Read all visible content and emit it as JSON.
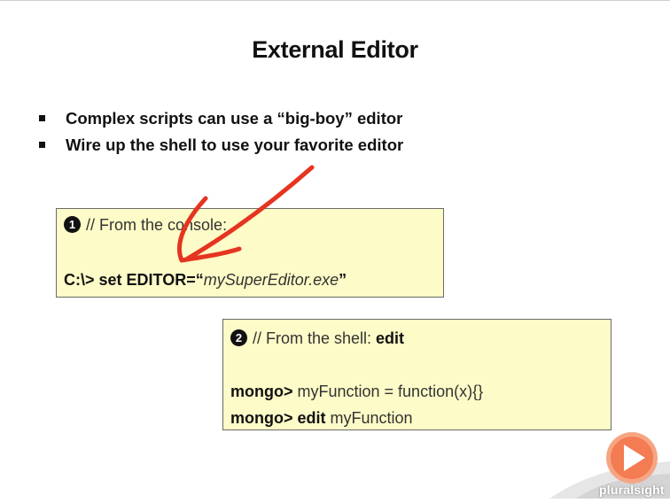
{
  "slide": {
    "title": "External Editor",
    "bullets": [
      "Complex scripts can use a “big-boy” editor",
      "Wire up the shell to use your favorite editor"
    ]
  },
  "box1": {
    "badge": "1",
    "comment": "// From the console:",
    "prompt": "C:\\> set EDITOR=“",
    "value": "mySuperEditor.exe",
    "close_quote": "”"
  },
  "box2": {
    "badge": "2",
    "comment": "// From the shell: ",
    "comment_keyword": "edit",
    "line1_prompt": "mongo> ",
    "line1_code": "myFunction = function(x){}",
    "line2_prompt": "mongo> ",
    "line2_keyword": "edit",
    "line2_code": " myFunction"
  },
  "branding": {
    "logo_text": "pluralsight",
    "accent": "#f15b2a",
    "arrow_color": "#e53420"
  }
}
